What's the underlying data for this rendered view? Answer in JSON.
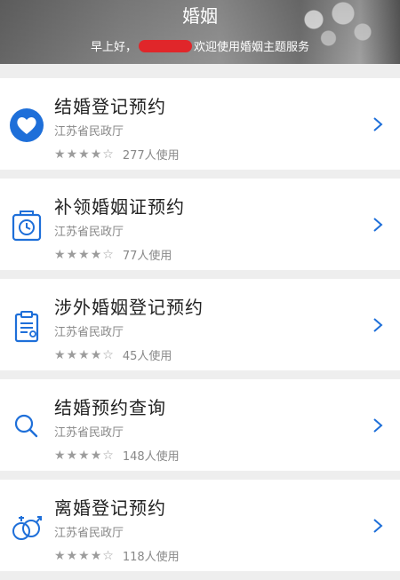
{
  "header": {
    "title": "婚姻",
    "greeting_prefix": "早上好，",
    "greeting_suffix": "欢迎使用婚姻主题服务"
  },
  "colors": {
    "accent": "#1e6fd9",
    "redaction": "#e0262a",
    "star": "#9c9c9c"
  },
  "services": [
    {
      "title": "结婚登记预约",
      "org": "江苏省民政厅",
      "rating": 4,
      "usage": "277人使用",
      "icon": "heart-icon"
    },
    {
      "title": "补领婚姻证预约",
      "org": "江苏省民政厅",
      "rating": 4,
      "usage": "77人使用",
      "icon": "timer-icon"
    },
    {
      "title": "涉外婚姻登记预约",
      "org": "江苏省民政厅",
      "rating": 4,
      "usage": "45人使用",
      "icon": "clipboard-icon"
    },
    {
      "title": "结婚预约查询",
      "org": "江苏省民政厅",
      "rating": 4,
      "usage": "148人使用",
      "icon": "search-icon"
    },
    {
      "title": "离婚登记预约",
      "org": "江苏省民政厅",
      "rating": 4,
      "usage": "118人使用",
      "icon": "gender-rings-icon"
    }
  ]
}
